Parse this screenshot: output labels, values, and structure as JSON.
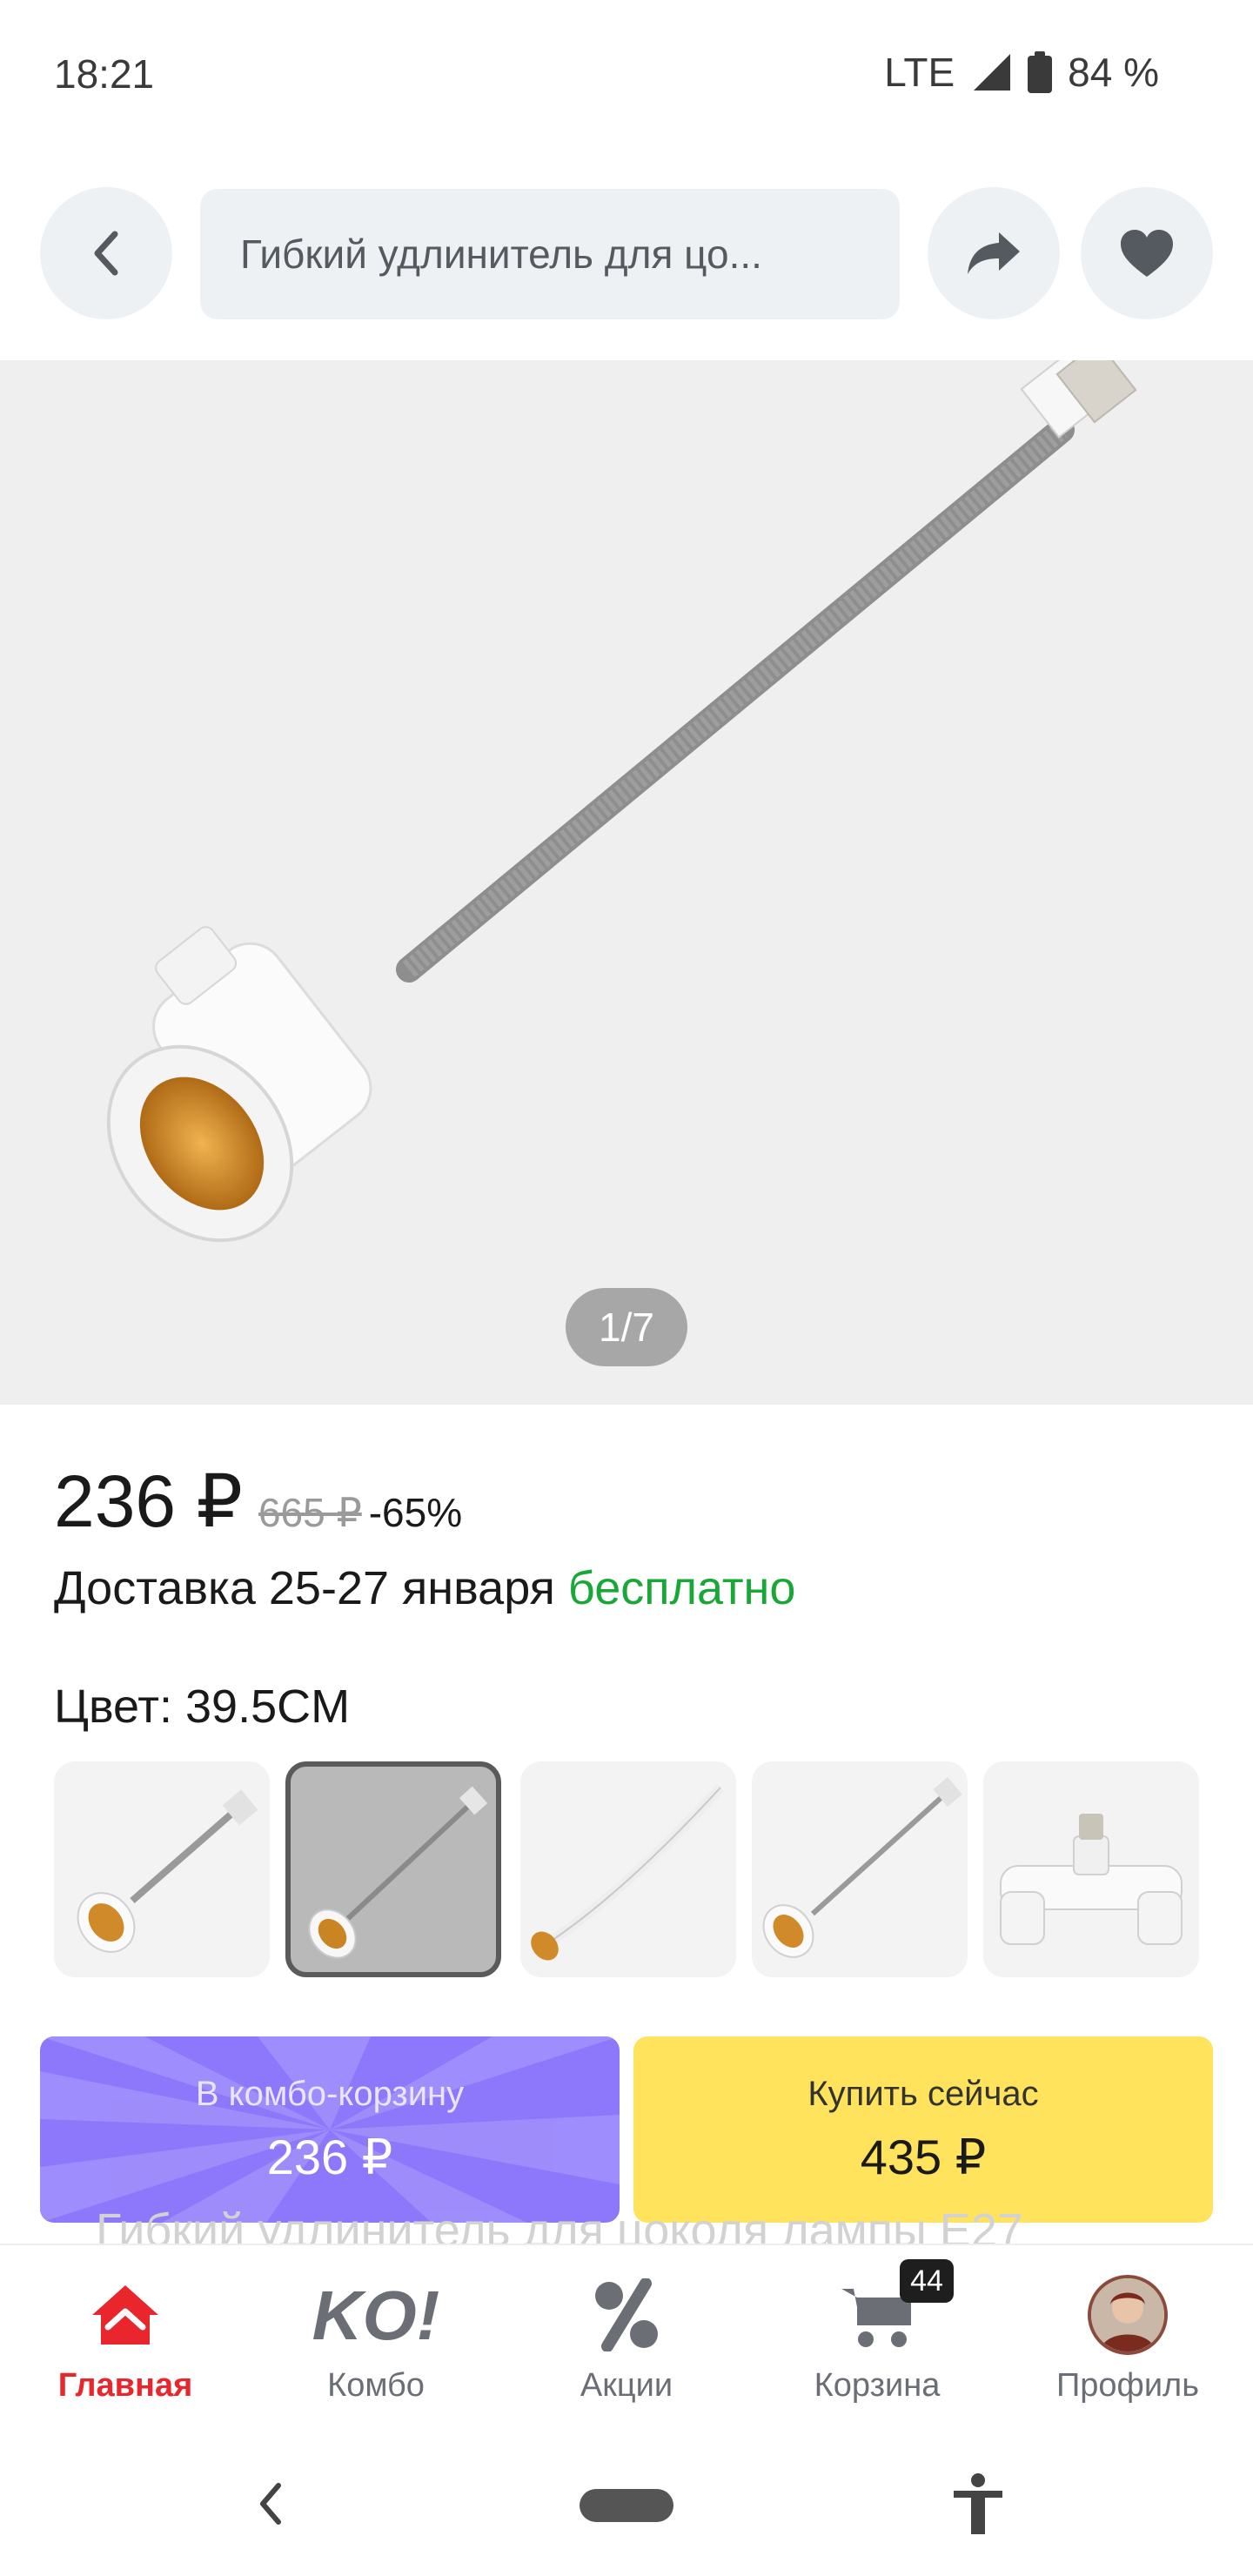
{
  "status_bar": {
    "time": "18:21",
    "network": "LTE",
    "battery": "84 %",
    "icons": [
      "signal-icon",
      "battery-icon"
    ]
  },
  "header": {
    "search_text": "Гибкий удлинитель для цо...",
    "icons": [
      "back-arrow-icon",
      "share-icon",
      "heart-icon"
    ]
  },
  "gallery": {
    "pager": "1/7",
    "current_image": 1,
    "total_images": 7
  },
  "product": {
    "price": "236 ₽",
    "old_price": "665 ₽",
    "discount": "-65%",
    "delivery_prefix": "Доставка 25-27 января",
    "delivery_free": "бесплатно",
    "color_label": "Цвет: 39.5CM",
    "selected_swatch_index": 1,
    "swatch_count": 5
  },
  "actions": {
    "combo_label": "В комбо-корзину",
    "combo_price": "236 ₽",
    "buy_label": "Купить сейчас",
    "buy_price": "435 ₽"
  },
  "background_text": "Гибкий удлинитель для цоколя лампы E27",
  "bottom_nav": {
    "items": [
      {
        "label": "Главная",
        "icon": "home-icon",
        "active": true
      },
      {
        "label": "Комбо",
        "icon": "combo-logo-icon",
        "active": false
      },
      {
        "label": "Акции",
        "icon": "percent-icon",
        "active": false
      },
      {
        "label": "Корзина",
        "icon": "cart-icon",
        "active": false
      },
      {
        "label": "Профиль",
        "icon": "avatar",
        "active": false
      }
    ],
    "cart_badge": "44",
    "combo_logo_text": "KO!"
  },
  "colors": {
    "accent_red": "#e8262b",
    "combo_purple": "#8d78fb",
    "buy_yellow": "#ffe35c",
    "free_green": "#19a838"
  }
}
